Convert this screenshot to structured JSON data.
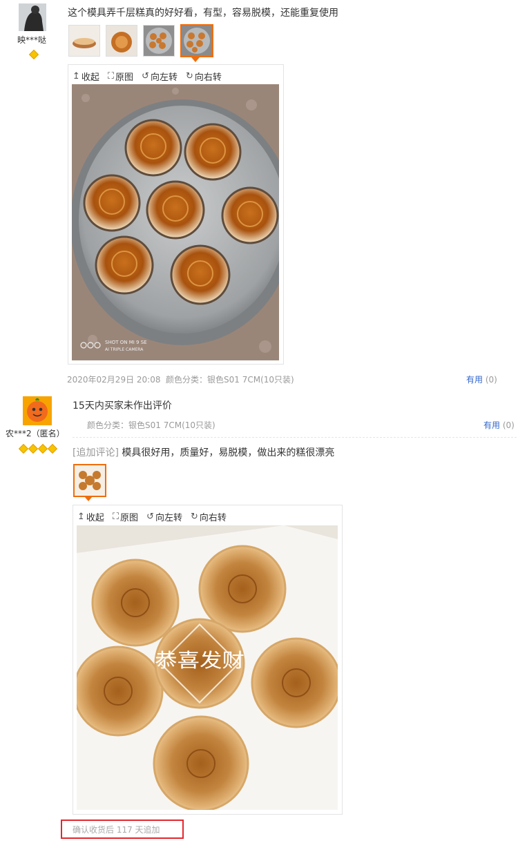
{
  "review1": {
    "username": "映***哒",
    "text": "这个模具弄千层糕真的好好看，有型，容易脱模，还能重复使用",
    "thumb_count": 4,
    "viewer": {
      "collapse": "收起",
      "original": "原图",
      "rotate_left": "向左转",
      "rotate_right": "向右转",
      "watermark_line1": "SHOT ON MI 9 SE",
      "watermark_line2": "AI TRIPLE CAMERA"
    },
    "date": "2020年02月29日 20:08",
    "sku": "颜色分类：银色S01 7CM(10只装)",
    "useful_label": "有用",
    "useful_count": "(0)"
  },
  "review2": {
    "username": "农***2（匿名）",
    "text": "15天内买家未作出评价",
    "sku": "颜色分类：银色S01 7CM(10只装)",
    "useful_label": "有用",
    "useful_count": "(0)",
    "append_tag": "[追加评论]",
    "append_text": "模具很好用，质量好，易脱模，做出来的糕很漂亮",
    "viewer": {
      "collapse": "收起",
      "original": "原图",
      "rotate_left": "向左转",
      "rotate_right": "向右转",
      "stamp_text": "恭喜发财"
    },
    "append_time": "确认收货后 117 天追加"
  },
  "colors": {
    "accent_orange": "#f06d0c",
    "link_blue": "#3366cc",
    "highlight_red": "#e4262e"
  }
}
